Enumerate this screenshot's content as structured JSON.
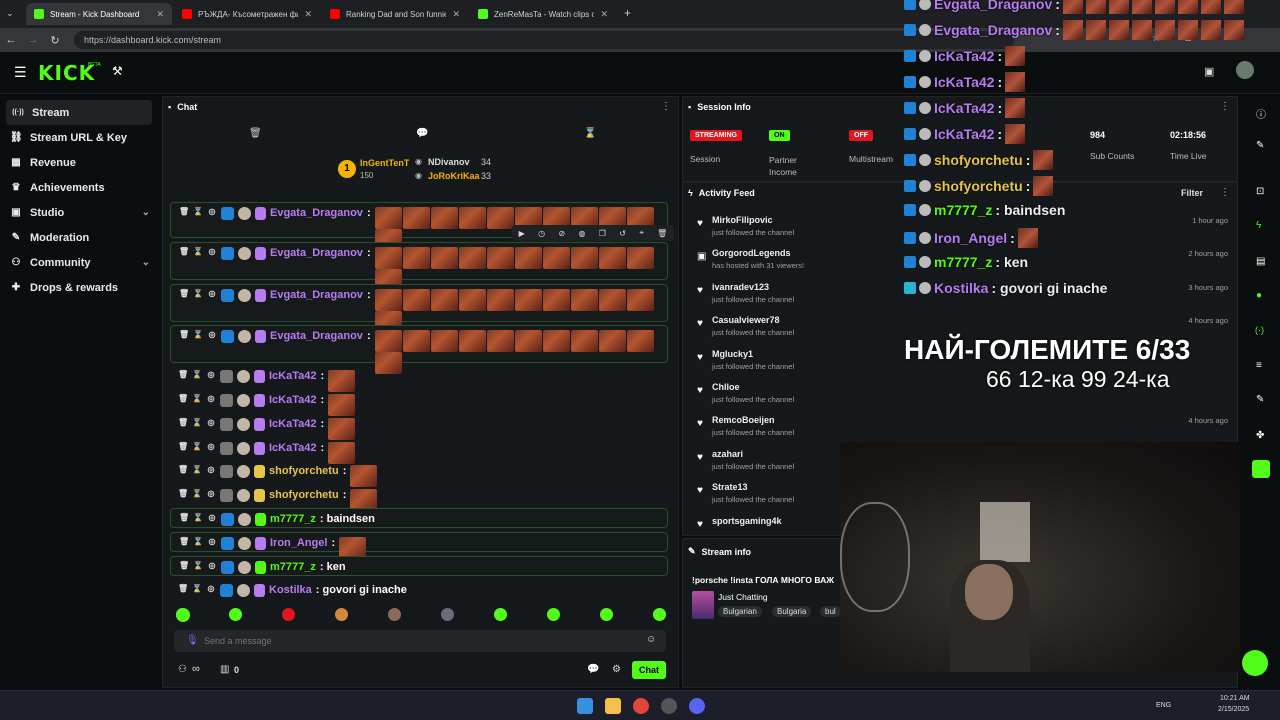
{
  "browser": {
    "tabs": [
      {
        "label": "Stream - Kick Dashboard",
        "color": "#53fc18"
      },
      {
        "label": "РЪЖДА- Късометражен фили",
        "color": "#ff0000"
      },
      {
        "label": "Ranking Dad and Son funniest",
        "color": "#ff0000"
      },
      {
        "label": "ZenReMasTa - Watch clips on K",
        "color": "#53fc18"
      }
    ],
    "url": "https://dashboard.kick.com/stream"
  },
  "header": {
    "logo": "KICK",
    "beta": "BETA"
  },
  "sidebar": {
    "items": [
      {
        "label": "Stream",
        "icon": "stream-icon",
        "glyph": "((·))"
      },
      {
        "label": "Stream URL & Key",
        "icon": "link-icon",
        "glyph": "🔗"
      },
      {
        "label": "Revenue",
        "icon": "revenue-icon",
        "glyph": "▦"
      },
      {
        "label": "Achievements",
        "icon": "trophy-icon",
        "glyph": "🏆"
      },
      {
        "label": "Studio",
        "icon": "studio-icon",
        "glyph": "▣",
        "chevron": "⌄"
      },
      {
        "label": "Moderation",
        "icon": "wrench-icon",
        "glyph": "🔧"
      },
      {
        "label": "Community",
        "icon": "community-icon",
        "glyph": "👥",
        "chevron": "⌄"
      },
      {
        "label": "Drops & rewards",
        "icon": "gift-icon",
        "glyph": "🎁"
      }
    ]
  },
  "chat": {
    "title": "Chat",
    "leaderboard": [
      {
        "rank": "1",
        "name": "InGentTenT",
        "count": "150"
      },
      {
        "name": "NDivanov",
        "count": "34"
      },
      {
        "name": "JoRoKriKaa",
        "count": "33"
      }
    ],
    "messages": [
      {
        "user": "Evgata_Draganov",
        "text": ":",
        "emotes": 11
      },
      {
        "user": "Evgata_Draganov",
        "text": ":",
        "emotes": 11
      },
      {
        "user": "Evgata_Draganov",
        "text": ":",
        "emotes": 11
      },
      {
        "user": "Evgata_Draganov",
        "text": ":",
        "emotes": 11
      },
      {
        "user": "IcKaTa42",
        "text": ":",
        "emotes": 1
      },
      {
        "user": "IcKaTa42",
        "text": ":",
        "emotes": 1
      },
      {
        "user": "IcKaTa42",
        "text": ":",
        "emotes": 1
      },
      {
        "user": "IcKaTa42",
        "text": ":",
        "emotes": 1
      },
      {
        "user": "shofyorchetu",
        "text": ":",
        "emotes": 1
      },
      {
        "user": "shofyorchetu",
        "text": ":",
        "emotes": 1
      },
      {
        "user": "m7777_z",
        "text": ": baindsen",
        "emotes": 0
      },
      {
        "user": "Iron_Angel",
        "text": ":",
        "emotes": 1
      },
      {
        "user": "m7777_z",
        "text": ": ken",
        "emotes": 0
      },
      {
        "user": "Kostilka",
        "text": ": govori gi inache",
        "emotes": 0
      }
    ],
    "input_placeholder": "Send a message",
    "infinity": "∞",
    "count": "0",
    "send_label": "Chat"
  },
  "session": {
    "title": "Session Info",
    "stats": [
      {
        "badge": "STREAMING",
        "label": "Session",
        "color": "#e2161e"
      },
      {
        "badge": "ON",
        "label": "Partner Income",
        "color": "#53fc18"
      },
      {
        "badge": "OFF",
        "label": "Multistream",
        "color": "#e2161e"
      },
      {
        "value": "984",
        "label": "Sub Counts"
      },
      {
        "value": "02:18:56",
        "label": "Time Live"
      }
    ]
  },
  "activity": {
    "title": "Activity Feed",
    "filter": "Filter",
    "items": [
      {
        "name": "MirkoFilipovic",
        "sub": "just followed the channel",
        "time": "1 hour ago"
      },
      {
        "name": "GorgorodLegends",
        "sub": "has hosted with 31 viewers!",
        "time": "2 hours ago"
      },
      {
        "name": "ivanradev123",
        "sub": "just followed the channel",
        "time": "3 hours ago"
      },
      {
        "name": "Casualviewer78",
        "sub": "just followed the channel",
        "time": "4 hours ago"
      },
      {
        "name": "Mglucky1",
        "sub": "just followed the channel",
        "time": ""
      },
      {
        "name": "Chlloe",
        "sub": "just followed the channel",
        "time": ""
      },
      {
        "name": "RemcoBoeijen",
        "sub": "just followed the channel",
        "time": "4 hours ago"
      },
      {
        "name": "azahari",
        "sub": "just followed the channel",
        "time": ""
      },
      {
        "name": "Strate13",
        "sub": "just followed the channel",
        "time": ""
      },
      {
        "name": "sportsgaming4k",
        "sub": "",
        "time": ""
      }
    ]
  },
  "stream_info": {
    "title": "Stream info",
    "stream_title": "!porsche !insta ГОЛА МНОГО ВАЖ",
    "category": "Just Chatting",
    "tags": [
      "Bulgarian",
      "Bulgaria",
      "bul"
    ]
  },
  "overlay": {
    "chat": [
      {
        "user": "Evgata_Draganov",
        "text": ":"
      },
      {
        "user": "Evgata_Draganov",
        "text": ":"
      },
      {
        "user": "IcKaTa42",
        "text": ":"
      },
      {
        "user": "IcKaTa42",
        "text": ":"
      },
      {
        "user": "IcKaTa42",
        "text": ":"
      },
      {
        "user": "IcKaTa42",
        "text": ":"
      },
      {
        "user": "shofyorchetu",
        "text": ":"
      },
      {
        "user": "shofyorchetu",
        "text": ":"
      },
      {
        "user": "m7777_z",
        "text": ": baindsen"
      },
      {
        "user": "Iron_Angel",
        "text": ":"
      },
      {
        "user": "m7777_z",
        "text": ": ken"
      },
      {
        "user": "Kostilka",
        "text": ": govori gi inache"
      }
    ],
    "headline": "НАЙ-ГОЛЕМИТЕ 6/33",
    "subline": "66 12-ка 99 24-ка"
  },
  "taskbar": {
    "lang": "ENG",
    "time": "10:21 AM",
    "date": "2/15/2025"
  }
}
